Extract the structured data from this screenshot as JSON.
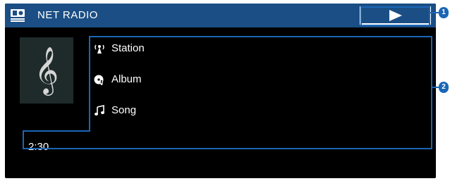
{
  "header": {
    "source_icon": "net-radio-icon",
    "source_title": "NET RADIO",
    "playback_icon": "play-icon"
  },
  "album_art": {
    "icon": "treble-clef-icon",
    "glyph": "𝄞"
  },
  "track_info": [
    {
      "icon": "antenna-icon",
      "label": "Station"
    },
    {
      "icon": "album-disc-icon",
      "label": "Album"
    },
    {
      "icon": "music-note-icon",
      "label": "Song"
    }
  ],
  "playback": {
    "elapsed": "2:30"
  },
  "callouts": [
    {
      "label": "1"
    },
    {
      "label": "2"
    }
  ],
  "colors": {
    "title_bar": "#1b4e84",
    "screen_background": "#000000",
    "callout_line": "#1b66b5",
    "text": "#ffffff"
  }
}
